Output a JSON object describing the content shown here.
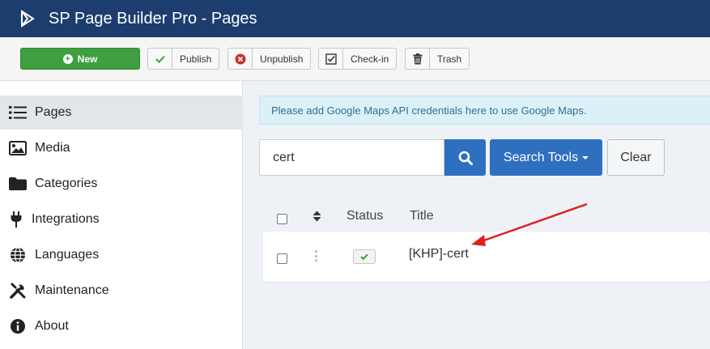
{
  "header": {
    "title": "SP Page Builder Pro - Pages"
  },
  "toolbar": {
    "new_label": "New",
    "publish_label": "Publish",
    "unpublish_label": "Unpublish",
    "checkin_label": "Check-in",
    "trash_label": "Trash"
  },
  "sidebar": {
    "items": [
      {
        "label": "Pages",
        "icon": "list-icon",
        "active": true
      },
      {
        "label": "Media",
        "icon": "image-icon"
      },
      {
        "label": "Categories",
        "icon": "folder-icon"
      },
      {
        "label": "Integrations",
        "icon": "plug-icon"
      },
      {
        "label": "Languages",
        "icon": "globe-icon"
      },
      {
        "label": "Maintenance",
        "icon": "tools-icon"
      },
      {
        "label": "About",
        "icon": "info-icon"
      }
    ]
  },
  "main": {
    "alert": "Please add Google Maps API credentials here to use Google Maps.",
    "search": {
      "value": "cert"
    },
    "search_tools_label": "Search Tools",
    "clear_label": "Clear",
    "table": {
      "headers": {
        "status": "Status",
        "title": "Title"
      },
      "rows": [
        {
          "title": "[KHP]-cert",
          "published": true
        }
      ]
    }
  },
  "colors": {
    "header_bg": "#1c3d6e",
    "primary": "#2f6fbf",
    "success": "#3f9e3f",
    "danger": "#c9302c",
    "annotation_arrow": "#e02020"
  }
}
